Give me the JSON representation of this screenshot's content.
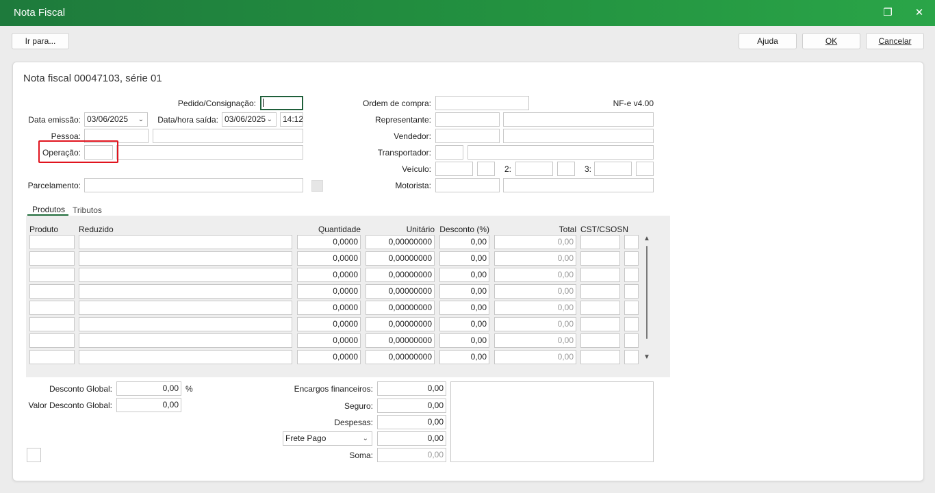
{
  "window": {
    "title": "Nota Fiscal",
    "restore_glyph": "❐",
    "close_glyph": "✕"
  },
  "toolbar": {
    "goto_label": "Ir para...",
    "help_label": "Ajuda",
    "ok_label": "OK",
    "cancel_label": "Cancelar"
  },
  "form": {
    "heading": "Nota fiscal 00047103, série 01",
    "nfe_version": "NF-e v4.00",
    "pedido_label": "Pedido/Consignação:",
    "pedido_value": "",
    "data_emissao_label": "Data emissão:",
    "data_emissao_value": "03/06/2025",
    "data_saida_label": "Data/hora saída:",
    "data_saida_value": "03/06/2025",
    "hora_saida_value": "14:12",
    "pessoa_label": "Pessoa:",
    "operacao_label": "Operação:",
    "parcelamento_label": "Parcelamento:",
    "ordem_compra_label": "Ordem de compra:",
    "representante_label": "Representante:",
    "vendedor_label": "Vendedor:",
    "transportador_label": "Transportador:",
    "veiculo_label": "Veículo:",
    "veiculo_2_label": "2:",
    "veiculo_3_label": "3:",
    "motorista_label": "Motorista:"
  },
  "tabs": [
    "Produtos",
    "Tributos"
  ],
  "products_table": {
    "columns": [
      "Produto",
      "Reduzido",
      "Quantidade",
      "Unitário",
      "Desconto (%)",
      "Total",
      "CST/CSOSN"
    ],
    "rows": [
      {
        "produto": "",
        "reduzido": "",
        "quantidade": "0,0000",
        "unitario": "0,00000000",
        "desconto": "0,00",
        "total": "0,00",
        "cst": ""
      },
      {
        "produto": "",
        "reduzido": "",
        "quantidade": "0,0000",
        "unitario": "0,00000000",
        "desconto": "0,00",
        "total": "0,00",
        "cst": ""
      },
      {
        "produto": "",
        "reduzido": "",
        "quantidade": "0,0000",
        "unitario": "0,00000000",
        "desconto": "0,00",
        "total": "0,00",
        "cst": ""
      },
      {
        "produto": "",
        "reduzido": "",
        "quantidade": "0,0000",
        "unitario": "0,00000000",
        "desconto": "0,00",
        "total": "0,00",
        "cst": ""
      },
      {
        "produto": "",
        "reduzido": "",
        "quantidade": "0,0000",
        "unitario": "0,00000000",
        "desconto": "0,00",
        "total": "0,00",
        "cst": ""
      },
      {
        "produto": "",
        "reduzido": "",
        "quantidade": "0,0000",
        "unitario": "0,00000000",
        "desconto": "0,00",
        "total": "0,00",
        "cst": ""
      },
      {
        "produto": "",
        "reduzido": "",
        "quantidade": "0,0000",
        "unitario": "0,00000000",
        "desconto": "0,00",
        "total": "0,00",
        "cst": ""
      },
      {
        "produto": "",
        "reduzido": "",
        "quantidade": "0,0000",
        "unitario": "0,00000000",
        "desconto": "0,00",
        "total": "0,00",
        "cst": ""
      }
    ]
  },
  "totals": {
    "desconto_global_label": "Desconto Global:",
    "desconto_global_value": "0,00",
    "percent_symbol": "%",
    "valor_desconto_label": "Valor Desconto Global:",
    "valor_desconto_value": "0,00",
    "encargos_label": "Encargos financeiros:",
    "encargos_value": "0,00",
    "seguro_label": "Seguro:",
    "seguro_value": "0,00",
    "despesas_label": "Despesas:",
    "despesas_value": "0,00",
    "frete_option": "Frete Pago",
    "frete_value": "0,00",
    "soma_label": "Soma:",
    "soma_value": "0,00"
  },
  "colors": {
    "titlebar": "#239240",
    "highlight": "#e0141e",
    "focus_border": "#1f5f3a"
  }
}
